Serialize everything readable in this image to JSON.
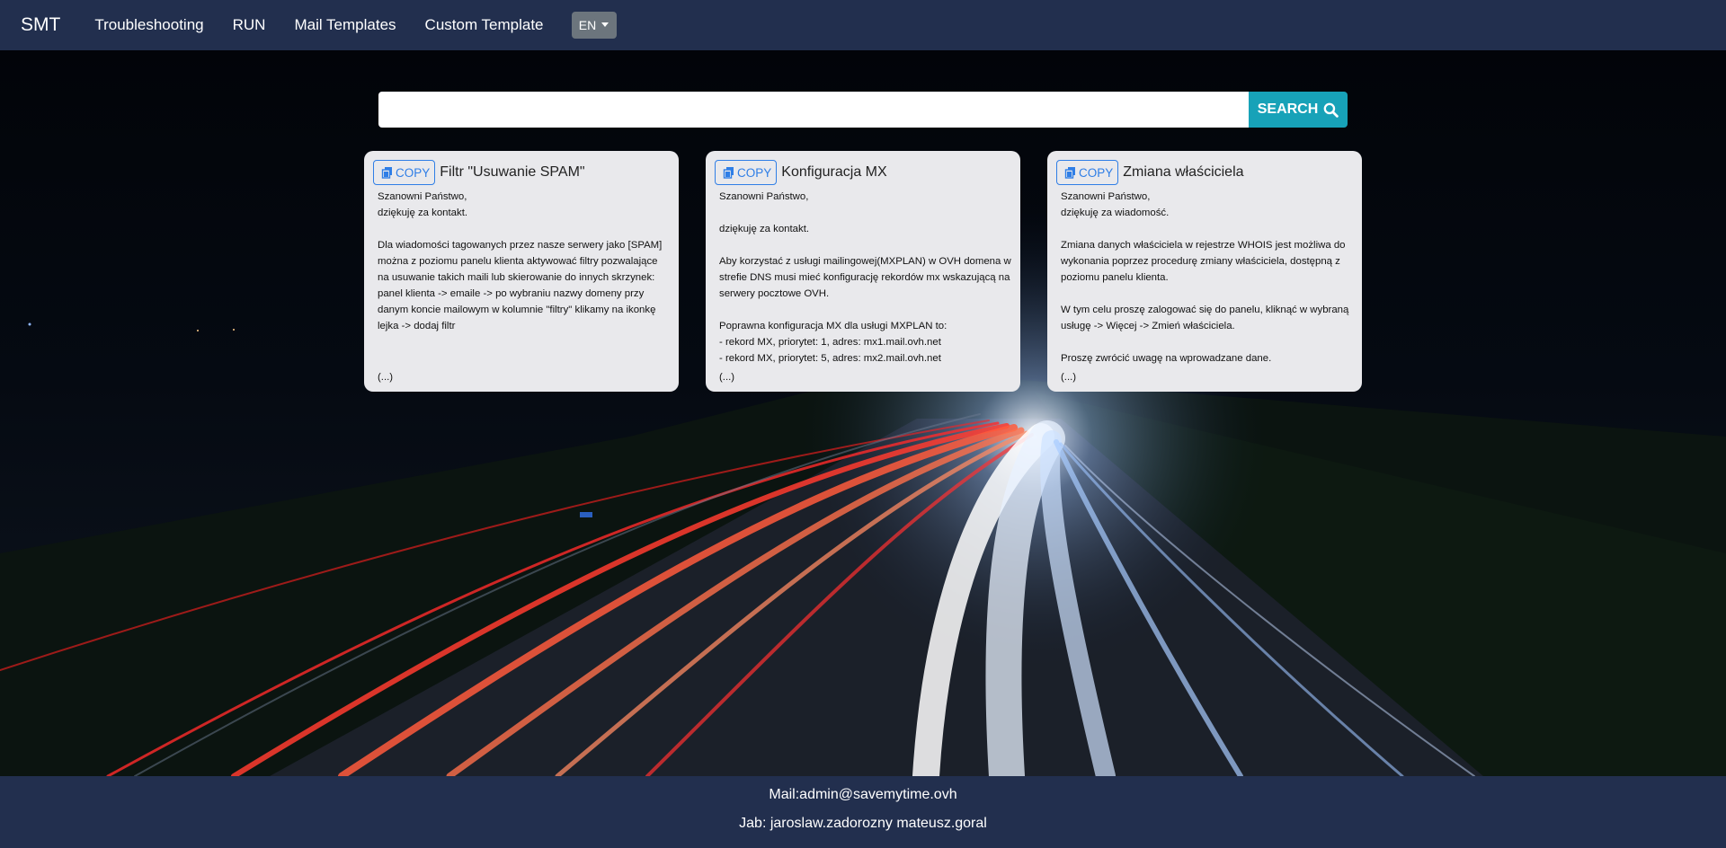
{
  "nav": {
    "brand": "SMT",
    "links": [
      "Troubleshooting",
      "RUN",
      "Mail Templates",
      "Custom Template"
    ],
    "language": "EN"
  },
  "search": {
    "placeholder": "",
    "button_label": "SEARCH"
  },
  "cards": [
    {
      "copy_label": "COPY",
      "title": "Filtr \"Usuwanie SPAM\"",
      "body": "Szanowni Państwo,\ndziękuję za kontakt.\n\nDla wiadomości tagowanych przez nasze serwery jako [SPAM] można z poziomu panelu klienta aktywować filtry pozwalające na usuwanie takich maili lub skierowanie do innych skrzynek:\npanel klienta -> emaile -> po wybraniu nazwy domeny przy danym koncie mailowym w kolumnie \"filtry\" klikamy na ikonkę lejka -> dodaj filtr",
      "ellipsis": "(...)"
    },
    {
      "copy_label": "COPY",
      "title": "Konfiguracja MX",
      "body": "Szanowni Państwo,\n\ndziękuję za kontakt.\n\nAby korzystać z usługi mailingowej(MXPLAN) w OVH domena w strefie DNS musi mieć konfigurację rekordów mx wskazującą na serwery pocztowe OVH.\n\nPoprawna konfiguracja MX dla usługi MXPLAN to:\n- rekord MX, priorytet: 1, adres: mx1.mail.ovh.net\n- rekord MX, priorytet: 5, adres: mx2.mail.ovh.net",
      "ellipsis": "(...)"
    },
    {
      "copy_label": "COPY",
      "title": "Zmiana właściciela",
      "body": "Szanowni Państwo,\ndziękuję za wiadomość.\n\nZmiana danych właściciela w rejestrze WHOIS jest możliwa do wykonania poprzez procedurę zmiany właściciela, dostępną z poziomu panelu klienta.\n\nW tym celu proszę zalogować się do panelu, kliknąć w wybraną usługę -> Więcej -> Zmień właściciela.\n\nProszę zwrócić uwagę na wprowadzane dane.",
      "ellipsis": "(...)"
    }
  ],
  "footer": {
    "mail": "Mail:admin@savemytime.ovh",
    "jab": "Jab: jaroslaw.zadorozny mateusz.goral"
  },
  "colors": {
    "navbar": "#222f4e",
    "search_button": "#17a2b8",
    "copy_button": "#2f7ee6",
    "card_bg": "#e9e9ec",
    "lang_button": "#6c757d"
  },
  "icons": {
    "search": "search-icon",
    "copy": "copy-icon",
    "dropdown": "chevron-down-icon"
  }
}
